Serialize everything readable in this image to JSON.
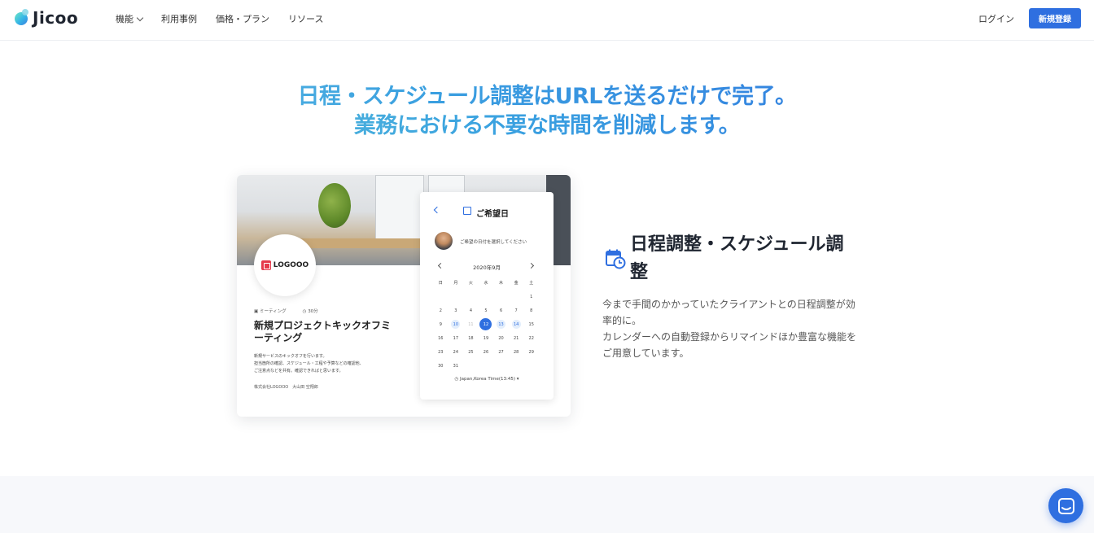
{
  "header": {
    "logo_text": "Jicoo",
    "nav": [
      {
        "label": "機能",
        "has_dropdown": true
      },
      {
        "label": "利用事例"
      },
      {
        "label": "価格・プラン"
      },
      {
        "label": "リソース"
      }
    ],
    "login": "ログイン",
    "signup": "新規登録"
  },
  "hero": {
    "line1": "日程・スケジュール調整はURLを送るだけで完了。",
    "line2": "業務における不要な時間を削減します。"
  },
  "mockup": {
    "brand": "LOGOOO",
    "meta_type": "ミーティング",
    "meta_duration": "30分",
    "event_title": "新規プロジェクトキックオフミーティング",
    "event_desc_1": "新規サービスのキックオフを行います。",
    "event_desc_2": "担当箇所の確認、スケジュール・工程や予算などの確認他、",
    "event_desc_3": "ご注意点などを共有。確認できればと思います。",
    "organizer": "株式会社LOGOOO　大山田 空翔郎",
    "calendar": {
      "header": "ご希望日",
      "prompt": "ご希望の日付を選択してください",
      "month": "2020年9月",
      "weekdays": [
        "日",
        "月",
        "火",
        "水",
        "木",
        "金",
        "土"
      ],
      "timezone": "Japan,Korea Time(13:45)",
      "selected_day": "12"
    }
  },
  "feature": {
    "title": "日程調整・スケジュール調整",
    "desc_1": "今まで手間のかかっていたクライアントとの日程調整が効率的に。",
    "desc_2": "カレンダーへの自動登録からリマインドほか豊富な機能をご用意しています。",
    "icon": "calendar-clock-icon"
  },
  "chat": {
    "icon": "chat-icon"
  },
  "colors": {
    "accent": "#2f6fe0",
    "gradient_start": "#63c3e2"
  }
}
